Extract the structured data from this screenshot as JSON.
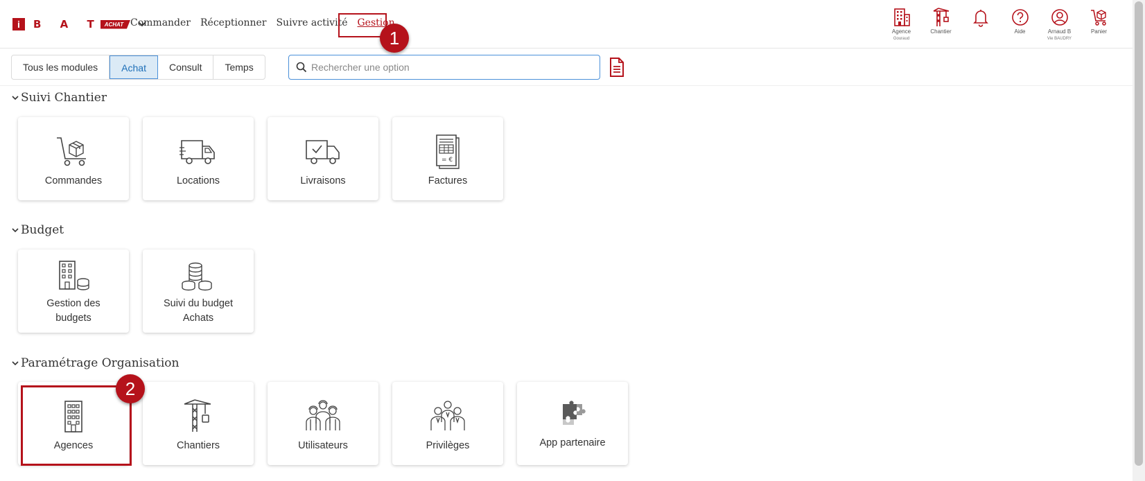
{
  "brand": {
    "letters": "B A T",
    "badge": "ACHAT",
    "i_letter": "i",
    "color": "#b5121b"
  },
  "nav": {
    "items": [
      {
        "label": "Commander"
      },
      {
        "label": "Réceptionner"
      },
      {
        "label": "Suivre activité"
      },
      {
        "label": "Gestion"
      }
    ]
  },
  "steps": {
    "one": "1",
    "two": "2"
  },
  "header_icons": [
    {
      "name": "building-icon",
      "label": "Agence",
      "sub": "Gouraud"
    },
    {
      "name": "crane-icon",
      "label": "Chantier",
      "sub": ""
    },
    {
      "name": "bell-icon",
      "label": "",
      "sub": ""
    },
    {
      "name": "help-icon",
      "label": "Aide",
      "sub": ""
    },
    {
      "name": "user-icon",
      "label": "Arnaud B",
      "sub": "Vie BAUDRY"
    },
    {
      "name": "cart-icon",
      "label": "Panier",
      "sub": ""
    }
  ],
  "modules": [
    "Tous les modules",
    "Achat",
    "Consult",
    "Temps"
  ],
  "search": {
    "placeholder": "Rechercher une option",
    "value": ""
  },
  "sections": {
    "suivi": {
      "title": "Suivi Chantier",
      "cards": [
        "Commandes",
        "Locations",
        "Livraisons",
        "Factures"
      ]
    },
    "budget": {
      "title": "Budget",
      "cards": [
        "Gestion des budgets",
        "Suivi du budget Achats"
      ]
    },
    "param": {
      "title": "Paramétrage Organisation",
      "cards": [
        "Agences",
        "Chantiers",
        "Utilisateurs",
        "Privilèges",
        "App partenaire"
      ]
    }
  }
}
